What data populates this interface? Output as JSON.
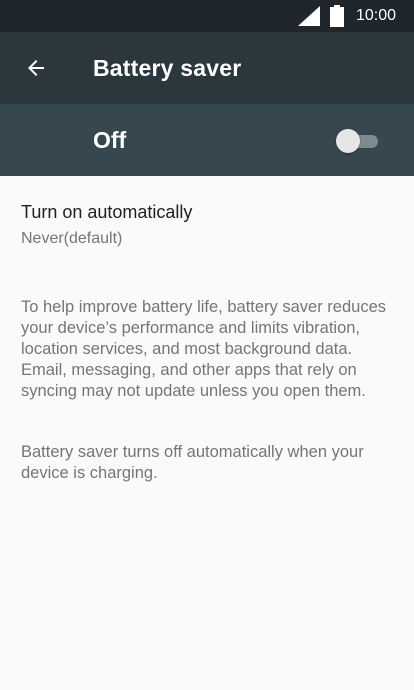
{
  "status_bar": {
    "time": "10:00",
    "icons": [
      "signal-icon",
      "battery-icon"
    ]
  },
  "toolbar": {
    "back_icon": "arrow-left-icon",
    "title": "Battery saver"
  },
  "master_switch": {
    "label": "Off",
    "checked": false
  },
  "preferences": {
    "turn_on_automatically": {
      "title": "Turn on automatically",
      "summary": "Never(default)"
    }
  },
  "description": {
    "paragraph1": "To help improve battery life, battery saver reduces your device’s performance and limits vibration, location services, and most background data. Email, messaging, and other apps that rely on syncing may not update unless you open them.",
    "paragraph2": "Battery saver turns off automatically when your device is charging."
  },
  "colors": {
    "status_bar": "#1f272d",
    "toolbar": "#2b363d",
    "switch_bar": "#37474f",
    "background": "#fafafa"
  }
}
